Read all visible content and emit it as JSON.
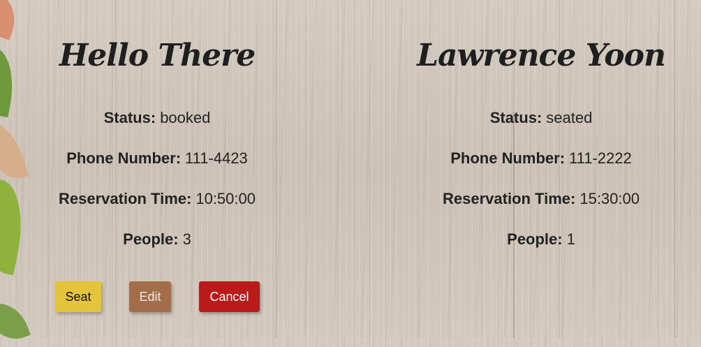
{
  "reservations": [
    {
      "name": "Hello There",
      "status_label": "Status:",
      "status": "booked",
      "phone_label": "Phone Number:",
      "phone": "111-4423",
      "time_label": "Reservation Time:",
      "time": "10:50:00",
      "people_label": "People:",
      "people": "3",
      "buttons": {
        "seat": "Seat",
        "edit": "Edit",
        "cancel": "Cancel"
      }
    },
    {
      "name": "Lawrence Yoon",
      "status_label": "Status:",
      "status": "seated",
      "phone_label": "Phone Number:",
      "phone": "111-2222",
      "time_label": "Reservation Time:",
      "time": "15:30:00",
      "people_label": "People:",
      "people": "1"
    }
  ],
  "colors": {
    "seat_button": "#e4c43a",
    "edit_button": "#a36d4a",
    "cancel_button": "#bb1a1a",
    "background": "#cdc3b8"
  }
}
